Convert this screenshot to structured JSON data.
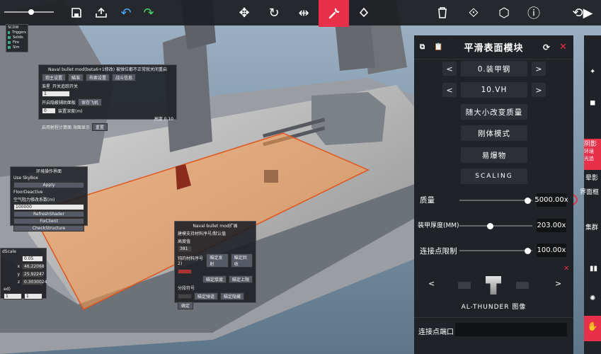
{
  "toolbar": {
    "icons": [
      "slider-icon",
      "save-icon",
      "share-icon",
      "undo-icon",
      "redo-icon",
      "move-icon",
      "rotate-icon",
      "scale-icon",
      "wrench-icon",
      "paint-icon",
      "trash-icon",
      "mirror-icon",
      "hexagon-icon",
      "info-icon",
      "sim-icon"
    ],
    "accent_color": "#e8304a"
  },
  "checkbox_panel": {
    "title": "SCDW",
    "items": [
      "Triggers",
      "Solids",
      "Fire",
      "Sim"
    ]
  },
  "naval_mod": {
    "title": "Naval bullet mod(beta6+1修改) 被弹位都不正常就关闭重启",
    "tabs": [
      "炮主设置",
      "瞄准",
      "布索设置",
      "战斗信息"
    ],
    "row1": "准星",
    "row1b": "开关追踪开关",
    "row2_field": "1",
    "row3": "开启隐蔽辅助面板",
    "row3_btn": "保存飞机",
    "row4_field": "0",
    "row4_label": "装置深度(m)",
    "row5": "高度 0.10",
    "row6": "启用射程计算面 海面显示",
    "row6_btn": "重置"
  },
  "env_panel": {
    "title": "环境操作界面",
    "items": [
      "Use SkyBox",
      "Apply",
      "FloorDeactive",
      "空气阻力修改系数(m)",
      "100000",
      "RefreshShader",
      "FixClient",
      "CheckStructure"
    ]
  },
  "left_stats": {
    "title": "dScale",
    "v1": "0.05",
    "x": "46.22068",
    "y": "25.92247",
    "z": "0.3030024",
    "label2": "ed)",
    "v2": "1",
    "v3": "1"
  },
  "naval_mod2": {
    "title": "Naval bullet mod扩展",
    "l1": "建模支持材料序号/默认值",
    "l1b": "高度值",
    "f1": "381",
    "l2": "钝的材料序号2)",
    "b1": "瞄定发射",
    "b2": "瞄定回收",
    "l3": "",
    "b3": "瞄定厚度",
    "b4": "瞄定上限",
    "l4": "分段符号",
    "b5": "瞄定弹道",
    "b6": "瞄定隐藏",
    "b7": "确定"
  },
  "main_panel": {
    "title": "平滑表面模块",
    "selector1": "0.装甲钢",
    "selector2": "10.VH",
    "buttons": [
      "随大小改变质量",
      "刚体模式",
      "易爆物",
      "SCALING"
    ],
    "sliders": [
      {
        "label": "质量",
        "value": "5000.00x",
        "fraction": 0.93
      },
      {
        "label": "装甲厚度(MM)",
        "value": "203.00x",
        "fraction": 0.42
      },
      {
        "label": "连接点限制",
        "value": "100.00x",
        "fraction": 0.93
      }
    ],
    "preview_caption": "AL-THUNDER 图像",
    "connection_label": "连接点端口",
    "connection_value": ""
  },
  "right_side": {
    "texts": [
      "阴影",
      "环境",
      "光追",
      "晕影",
      "界面框",
      "集群"
    ]
  }
}
